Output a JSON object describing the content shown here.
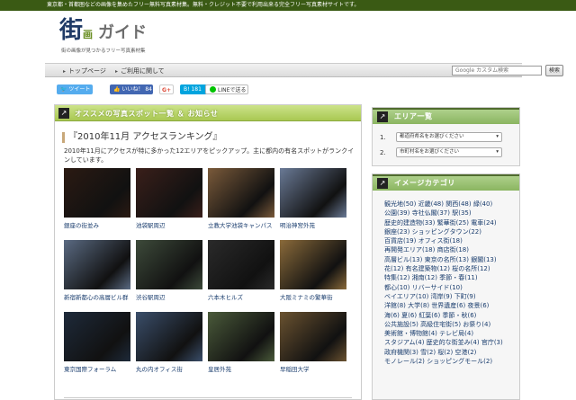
{
  "top_banner": "東京都・首都圏などの画像を集めたフリー無料写真素材集。無料・クレジット不要で利用出来る完全フリー写真素材サイトです。",
  "logo": {
    "main": "街",
    "sub": "画",
    "text": "ガイド",
    "tagline": "街の画像が見つかるフリー写真素材集"
  },
  "nav": {
    "items": [
      "トップページ",
      "ご利用に関して"
    ]
  },
  "search": {
    "placeholder": "Google カスタム検索",
    "button": "検索"
  },
  "share": {
    "tweet": "ツイート",
    "like": "いいね！ 84",
    "gplus": "G+",
    "hatena": "B! 181",
    "line": "LINEで送る"
  },
  "main": {
    "section_title": "オススメの写真スポット一覧 ＆ お知らせ",
    "article_title": "『2010年11月 アクセスランキング』",
    "intro": "2010年11月にアクセスが特に多かった12エリアをピックアップ。主に都内の有名スポットがランクインしています。",
    "photos": [
      {
        "caption": "銀座の街並み",
        "color": "#2b1a12"
      },
      {
        "caption": "池袋駅周辺",
        "color": "#3a1f1a"
      },
      {
        "caption": "立教大学池袋キャンパス",
        "color": "#7a5a3a"
      },
      {
        "caption": "明治神宮外苑",
        "color": "#6a7a96"
      },
      {
        "caption": "新宿新都心の高層ビル群",
        "color": "#5a6a82"
      },
      {
        "caption": "渋谷駅周辺",
        "color": "#3d4a3a"
      },
      {
        "caption": "六本木ヒルズ",
        "color": "#2a2a2a"
      },
      {
        "caption": "大阪ミナミの繁華街",
        "color": "#8a6a3a"
      },
      {
        "caption": "東京国際フォーラム",
        "color": "#1e2a3a"
      },
      {
        "caption": "丸の内オフィス街",
        "color": "#3a4e6a"
      },
      {
        "caption": "皇居外苑",
        "color": "#4a5a3a"
      },
      {
        "caption": "早稲田大学",
        "color": "#6a5230"
      }
    ]
  },
  "area": {
    "title": "エリア一覧",
    "rows": [
      {
        "num": "1.",
        "select": "都道府県名をお選びください"
      },
      {
        "num": "2.",
        "select": "市町村名をお選びください"
      }
    ]
  },
  "category": {
    "title": "イメージカテゴリ",
    "lines": [
      [
        "観光地(50)",
        "近畿(48)",
        "関西(48)",
        "緑(40)"
      ],
      [
        "公園(39)",
        "寺社仏閣(37)",
        "駅(35)"
      ],
      [
        "歴史的建造物(33)",
        "繁華街(25)",
        "電車(24)"
      ],
      [
        "銀座(23)",
        "ショッピングタウン(22)"
      ],
      [
        "百貨店(19)",
        "オフィス街(18)"
      ],
      [
        "再開発エリア(18)",
        "商店街(18)"
      ],
      [
        "高層ビル(13)",
        "東京の名所(13)",
        "銀閣(13)"
      ],
      [
        "花(12)",
        "有名建築物(12)",
        "桜の名所(12)"
      ],
      [
        "特集(12)",
        "湘南(12)",
        "季節・春(11)"
      ],
      [
        "都心(10)",
        "リバーサイド(10)"
      ],
      [
        "ベイエリア(10)",
        "湾岸(9)",
        "下町(9)"
      ],
      [
        "洋館(8)",
        "大学(8)",
        "世界遺産(6)",
        "夜景(6)"
      ],
      [
        "海(6)",
        "夏(6)",
        "紅葉(6)",
        "季節・秋(6)"
      ],
      [
        "公共施設(5)",
        "高級住宅街(5)",
        "お祭り(4)"
      ],
      [
        "美術館・博物館(4)",
        "テレビ局(4)"
      ],
      [
        "スタジアム(4)",
        "歴史的な街並み(4)",
        "官庁(3)"
      ],
      [
        "政府機関(3)",
        "雪(2)",
        "桜(2)",
        "空港(2)"
      ],
      [
        "モノレール(2)",
        "ショッピングモール(2)"
      ]
    ]
  }
}
